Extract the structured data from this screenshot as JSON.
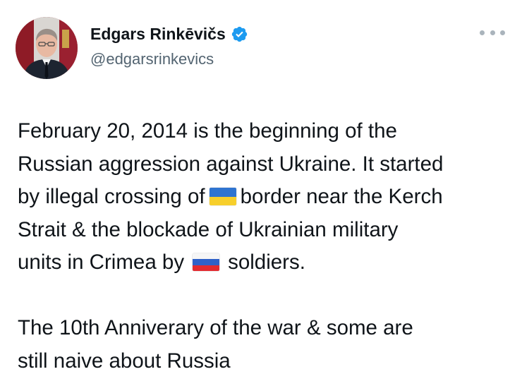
{
  "author": {
    "display_name": "Edgars Rinkēvičs",
    "handle": "@edgarsrinkevics",
    "verified": true
  },
  "icons": {
    "avatar": "profile-photo",
    "verified": "verified-badge-icon",
    "more": "more-options-icon",
    "flag_ua": "ukraine-flag-emoji",
    "flag_ru": "russia-flag-emoji"
  },
  "colors": {
    "text": "#0f1419",
    "secondary": "#536471",
    "verified_badge": "#1d9bf0"
  },
  "tweet": {
    "p1": {
      "line1": "February 20, 2014 is the beginning of the",
      "line2": "Russian aggression against Ukraine. It started",
      "line3_a": "by illegal crossing of",
      "line3_b": "border near the Kerch",
      "line4": "Strait & the blockade of Ukrainian military",
      "line5_a": "units in Crimea by",
      "line5_b": "soldiers."
    },
    "p2": {
      "line1": "The 10th Anniverary of the war & some are",
      "line2": "still naive about Russia"
    }
  }
}
